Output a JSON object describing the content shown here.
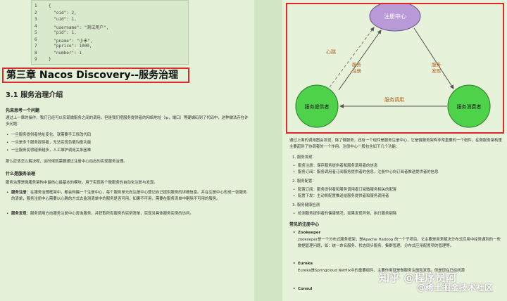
{
  "code_block": {
    "lines": [
      {
        "num": "1",
        "text": "{"
      },
      {
        "num": "2",
        "text": "  \"oid\": 2,"
      },
      {
        "num": "3",
        "text": "  \"uid\": 1,"
      },
      {
        "num": "4",
        "text": "  \"username\": \"测试用户\","
      },
      {
        "num": "5",
        "text": "  \"pid\": 1,"
      },
      {
        "num": "6",
        "text": "  \"pname\": \"小米\","
      },
      {
        "num": "7",
        "text": "  \"pprice\": 1000,"
      },
      {
        "num": "8",
        "text": "  \"number\": 1"
      },
      {
        "num": "9",
        "text": "}"
      }
    ]
  },
  "left": {
    "chapter_title": "第三章 Nacos Discovery--服务治理",
    "section_title": "3.1 服务治理介绍",
    "q_heading": "先来思考一个问题",
    "intro": "通过上一章的操作，我们已经可以实现微服务之间的调用。但是我们把服务提供者的网络地址（ip，端口）等硬编码到了代码中，这种做法存在许多问题：",
    "problems": [
      "一旦服务提供者地址变化，就需要手工修改代码",
      "一旦是多个服务提供者，无法实现负载均衡功能",
      "一旦服务变得越来越多，人工维护调用关系困难"
    ],
    "solution": "那么应该怎么解决呢，这时候就需要通过注册中心动态的实现服务治理。",
    "solution_bold": "服务治理",
    "what_heading": "什么是服务治理",
    "what_text": "服务治理是微服务架构中最核心最基本的模块。用于实现各个微服务的自动化注册与发现。",
    "items": [
      {
        "label": "服务注册：",
        "text": "在服务治理框架中，都会构建一个注册中心，每个服务单元向注册中心登记自己提供服务的详细信息。并在注册中心形成一张服务的清单，服务注册中心需要以心跳的方式去监测清单中的服务是否可用，如果不可用，需要在服务清单中剔除不可用的服务。"
      },
      {
        "label": "服务发现：",
        "text": "服务调用方向服务注册中心咨询服务，并获取所有服务的实例清单，实现对具体服务实例的访问。"
      }
    ]
  },
  "diagram": {
    "registry": "注册中心",
    "provider": "服务提供者",
    "consumer": "服务消费者",
    "heartbeat": "心跳",
    "register": "服务注册",
    "discover": "服务发现",
    "invoke": "服务调用"
  },
  "right": {
    "para1": "通过上面的调用图会发现，除了微服务，还有一个组件是服务注册中心，它是微服务架构非常重要的一个组件，在微服务架构里主要起到了协调者的一个作用。注册中心一般包含如下几个功能：",
    "f1": "1. 服务发现：",
    "f1a": "服务注册：保存服务提供者和服务调用者的信息",
    "f1b": "服务订阅：服务调用者订阅服务提供者的信息，注册中心向订阅者推送提供者的信息",
    "f2": "2. 服务配置：",
    "f2a": "配置订阅：服务提供者和服务调用者订阅微服务相关的配置",
    "f2b": "配置下发：主动将配置推送给服务提供者和服务调用者",
    "f3": "3. 服务健康检测",
    "f3a": "检测服务提供者的健康情况，如果发现异常，执行服务剔除",
    "common_heading": "常见的注册中心",
    "zk_name": "Zookeeper",
    "zk_text": "zookeeper是一个分布式服务框架，是Apache Hadoop 的一个子项目，它主要是用来解决分布式应用中经常遇到的一些数据管理问题，如：统一命名服务、状态同步服务、集群管理、分布式应用配置项的管理等。",
    "eureka_name": "Eureka",
    "eureka_text": "Eureka是Springcloud Netflix中的重要组件，主要作用就是做服务注册和发现。但是现在已经闭源",
    "consul_name": "Consul"
  },
  "watermark": {
    "line1": "知乎 @程序员阿",
    "line2": "@稀土掘金技术社区"
  }
}
